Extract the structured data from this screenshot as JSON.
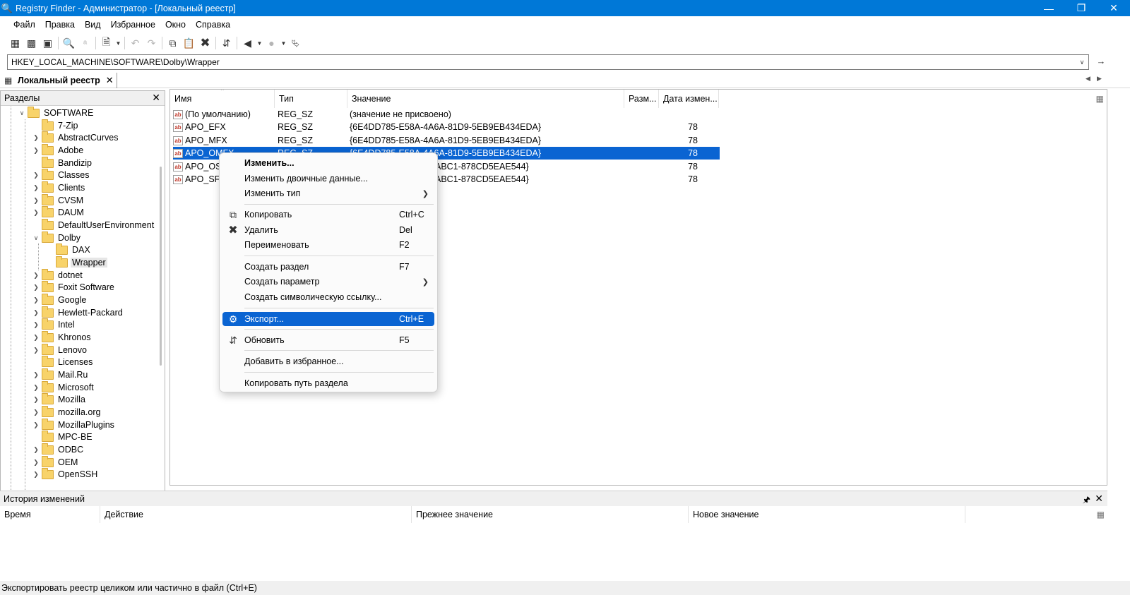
{
  "window": {
    "title": "Registry Finder - Администратор - [Локальный реестр]",
    "accent_color": "#0078d7"
  },
  "menu": [
    "Файл",
    "Правка",
    "Вид",
    "Избранное",
    "Окно",
    "Справка"
  ],
  "address": {
    "path": "HKEY_LOCAL_MACHINE\\SOFTWARE\\Dolby\\Wrapper"
  },
  "tab": {
    "label": "Локальный реестр"
  },
  "left_pane": {
    "title": "Разделы",
    "tree": [
      {
        "label": "SOFTWARE",
        "expanded": true
      },
      {
        "label": "7-Zip"
      },
      {
        "label": "AbstractCurves"
      },
      {
        "label": "Adobe"
      },
      {
        "label": "Bandizip"
      },
      {
        "label": "Classes"
      },
      {
        "label": "Clients"
      },
      {
        "label": "CVSM"
      },
      {
        "label": "DAUM"
      },
      {
        "label": "DefaultUserEnvironment"
      },
      {
        "label": "Dolby",
        "expanded": true
      },
      {
        "label": "DAX"
      },
      {
        "label": "Wrapper",
        "selected": true
      },
      {
        "label": "dotnet"
      },
      {
        "label": "Foxit Software"
      },
      {
        "label": "Google"
      },
      {
        "label": "Hewlett-Packard"
      },
      {
        "label": "Intel"
      },
      {
        "label": "Khronos"
      },
      {
        "label": "Lenovo"
      },
      {
        "label": "Licenses"
      },
      {
        "label": "Mail.Ru"
      },
      {
        "label": "Microsoft"
      },
      {
        "label": "Mozilla"
      },
      {
        "label": "mozilla.org"
      },
      {
        "label": "MozillaPlugins"
      },
      {
        "label": "MPC-BE"
      },
      {
        "label": "ODBC"
      },
      {
        "label": "OEM"
      },
      {
        "label": "OpenSSH"
      }
    ]
  },
  "list": {
    "columns": [
      "Имя",
      "Тип",
      "Значение",
      "Разм...",
      "Дата измен..."
    ],
    "rows": [
      {
        "name": "(По умолчанию)",
        "type": "REG_SZ",
        "value": "(значение не присвоено)",
        "size": ""
      },
      {
        "name": "APO_EFX",
        "type": "REG_SZ",
        "value": "{6E4DD785-E58A-4A6A-81D9-5EB9EB434EDA}",
        "size": "78"
      },
      {
        "name": "APO_MFX",
        "type": "REG_SZ",
        "value": "{6E4DD785-E58A-4A6A-81D9-5EB9EB434EDA}",
        "size": "78"
      },
      {
        "name": "APO_OMFX",
        "type": "REG_SZ",
        "value": "{6E4DD785-E58A-4A6A-81D9-5EB9EB434EDA}",
        "size": "78",
        "selected": true
      },
      {
        "name": "APO_OSFX",
        "type": "REG_SZ",
        "value": "ABC1-878CD5EAE544}",
        "size": "78"
      },
      {
        "name": "APO_SFX",
        "type": "REG_SZ",
        "value": "ABC1-878CD5EAE544}",
        "size": "78"
      }
    ]
  },
  "context_menu": {
    "items": [
      {
        "label": "Изменить...",
        "bold": true
      },
      {
        "label": "Изменить двоичные данные..."
      },
      {
        "label": "Изменить тип",
        "submenu": true
      },
      {
        "label": "Копировать",
        "shortcut": "Ctrl+C",
        "icon": "copy-icon"
      },
      {
        "label": "Удалить",
        "shortcut": "Del",
        "icon": "delete-icon"
      },
      {
        "label": "Переименовать",
        "shortcut": "F2"
      },
      {
        "label": "Создать раздел",
        "shortcut": "F7"
      },
      {
        "label": "Создать параметр",
        "submenu": true
      },
      {
        "label": "Создать символическую ссылку..."
      },
      {
        "label": "Экспорт...",
        "shortcut": "Ctrl+E",
        "icon": "export-icon",
        "highlighted": true
      },
      {
        "label": "Обновить",
        "shortcut": "F5",
        "icon": "refresh-icon"
      },
      {
        "label": "Добавить в избранное..."
      },
      {
        "label": "Копировать путь раздела"
      }
    ]
  },
  "history": {
    "title": "История изменений",
    "columns": [
      "Время",
      "Действие",
      "Прежнее значение",
      "Новое значение"
    ]
  },
  "status": {
    "text": "Экспортировать реестр целиком или частично в файл (Ctrl+E)"
  },
  "icons": {
    "app": "magnifier-icon",
    "toolbar": [
      "registry-icon",
      "remote-registry-icon",
      "load-hive-icon",
      "find-icon",
      "replace-icon",
      "export-icon",
      "undo-icon",
      "redo-icon",
      "copy-icon",
      "paste-icon",
      "delete-icon",
      "refresh-icon",
      "back-icon",
      "forward-icon",
      "parent-key-icon"
    ]
  },
  "colors": {
    "selection": "#0a64d2",
    "folder": "#f8d36a"
  }
}
